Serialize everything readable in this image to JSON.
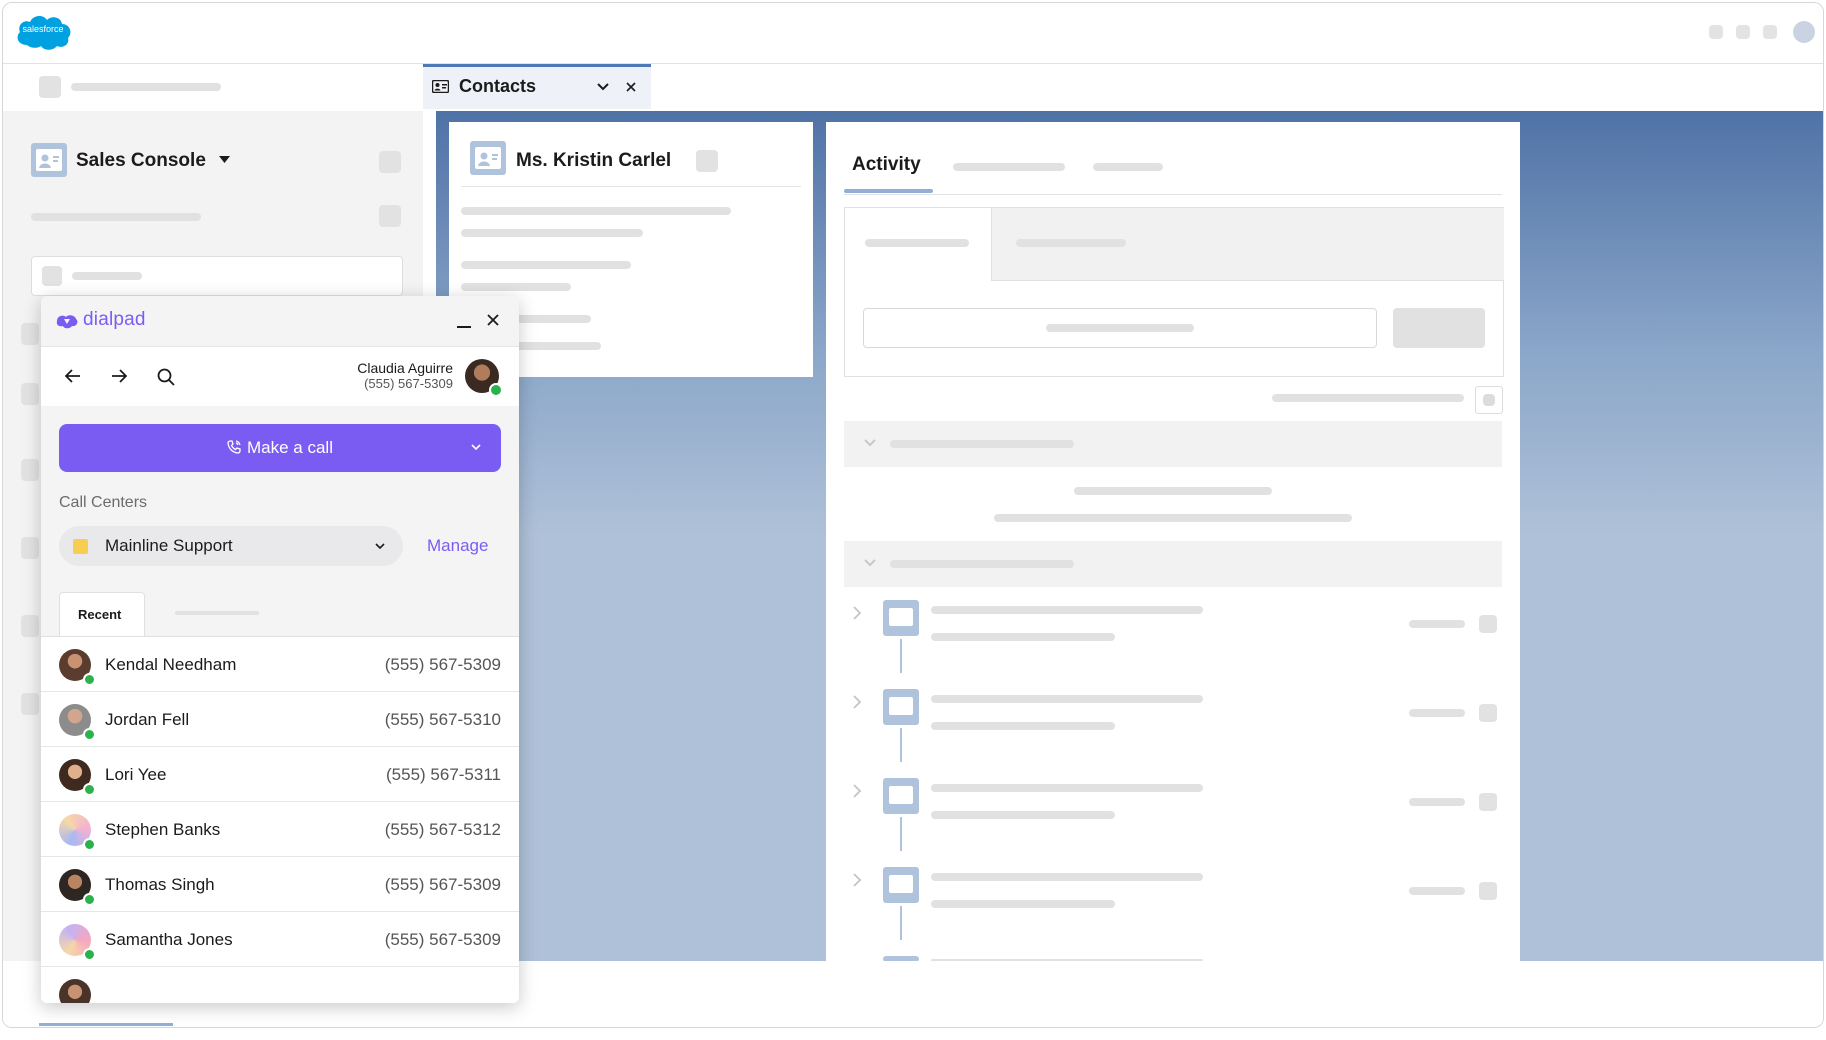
{
  "app": {
    "logo": "salesforce"
  },
  "tab": {
    "label": "Contacts"
  },
  "left_nav": {
    "title": "Sales Console"
  },
  "contact": {
    "name": "Ms. Kristin Carlel"
  },
  "activity": {
    "tab_label": "Activity"
  },
  "dialpad": {
    "brand": "dialpad",
    "user": {
      "name": "Claudia Aguirre",
      "phone": "(555) 567-5309"
    },
    "call_button": "Make a call",
    "call_centers_label": "Call Centers",
    "call_center_selected": "Mainline Support",
    "manage_link": "Manage",
    "recent_tab": "Recent",
    "contacts": [
      {
        "name": "Kendal Needham",
        "phone": "(555) 567-5309"
      },
      {
        "name": "Jordan Fell",
        "phone": "(555) 567-5310"
      },
      {
        "name": "Lori Yee",
        "phone": "(555) 567-5311"
      },
      {
        "name": "Stephen Banks",
        "phone": "(555) 567-5312"
      },
      {
        "name": "Thomas Singh",
        "phone": "(555) 567-5309"
      },
      {
        "name": "Samantha Jones",
        "phone": "(555) 567-5309"
      }
    ]
  },
  "colors": {
    "accent": "#7b5cf3",
    "salesforce_blue": "#00a1e0",
    "status_online": "#2bb24c",
    "call_center_swatch": "#f7cd52"
  }
}
